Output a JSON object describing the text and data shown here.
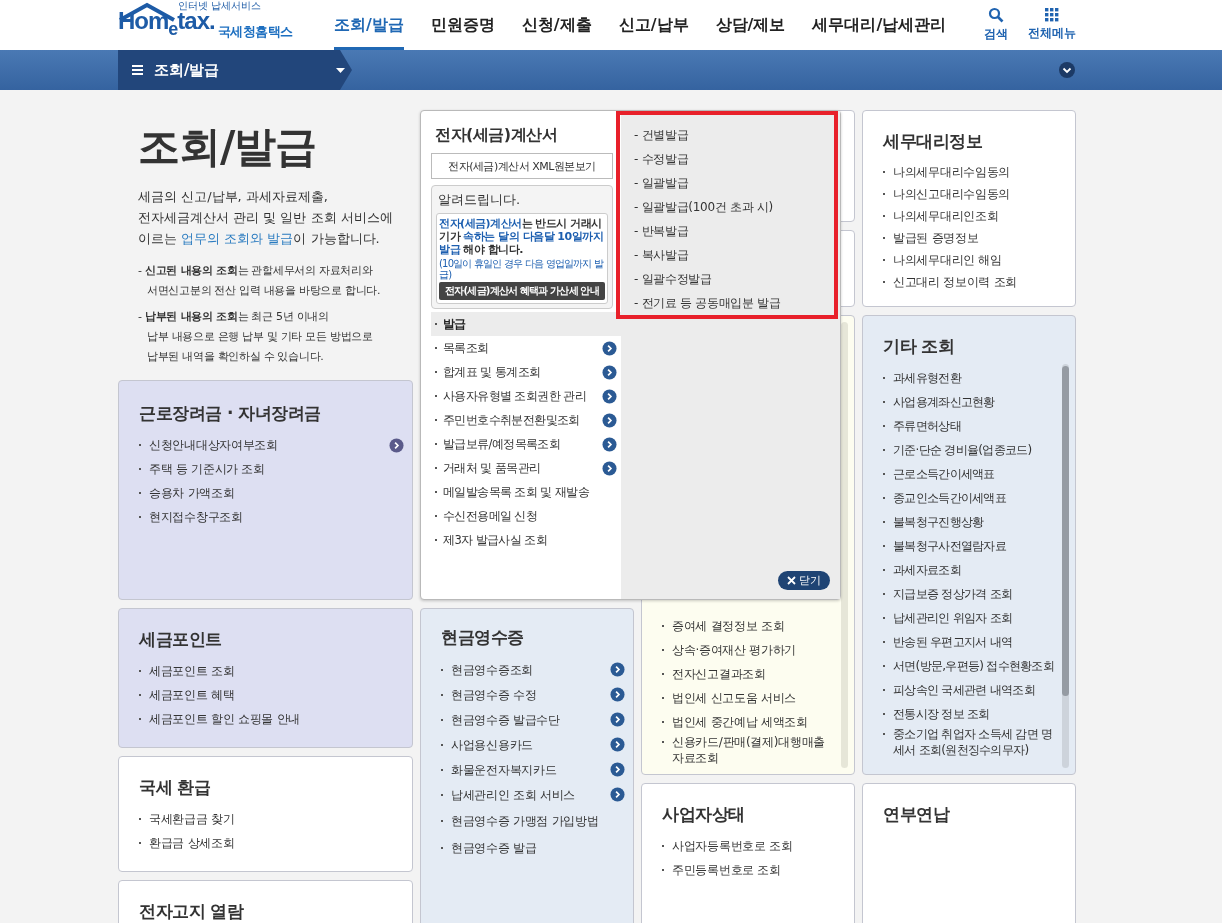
{
  "header": {
    "logo": {
      "tagline": "인터넷 납세서비스",
      "wordmark": "Hom$_{e}$tax.",
      "name": "국세청홈택스"
    },
    "nav": [
      {
        "label": "조회/발급",
        "selected": true
      },
      {
        "label": "민원증명",
        "selected": false
      },
      {
        "label": "신청/제출",
        "selected": false
      },
      {
        "label": "신고/납부",
        "selected": false
      },
      {
        "label": "상담/제보",
        "selected": false
      },
      {
        "label": "세무대리/납세관리",
        "selected": false
      }
    ],
    "tools": [
      {
        "kind": "search",
        "label": "검색"
      },
      {
        "kind": "menu",
        "label": "전체메뉴"
      }
    ]
  },
  "breadcrumb": {
    "label": "조회/발급"
  },
  "intro": {
    "title": "조회/발급",
    "description": "세금의 신고/납부, 과세자료제출,\n전자세금계산서 관리 및 일반 조회 서비스에\n이르는 **업무의 조회와 발급**이 가능합니다.",
    "notes": [
      "- **신고된 내용의 조회**는 관할세무서의 자료처리와\n서면신고분의 전산 입력 내용을 바탕으로 합니다.",
      "- **납부된 내용의 조회**는 최근 5년 이내의\n납부 내용으로 은행 납부 및 기타 모든 방법으로\n납부된 내역을 확인하실 수 있습니다."
    ]
  },
  "columns": [
    {
      "cards": [
        {
          "kind": "list",
          "color": "#dddff2",
          "title": "근로장려금 · 자녀장려금",
          "items": [
            {
              "label": "신청안내대상자여부조회",
              "arrow": true
            },
            {
              "label": "주택 등 기준시가 조회",
              "arrow": false
            },
            {
              "label": "승용차 가액조회",
              "arrow": false
            },
            {
              "label": "현지접수창구조회",
              "arrow": false
            }
          ]
        },
        {
          "kind": "list",
          "color": "#dddff2",
          "title": "세금포인트",
          "items": [
            {
              "label": "세금포인트 조회"
            },
            {
              "label": "세금포인트 혜택"
            },
            {
              "label": "세금포인트 할인 쇼핑몰 안내"
            }
          ]
        },
        {
          "kind": "list",
          "color": "#ffffff",
          "title": "국세 환급",
          "items": [
            {
              "label": "국세환급금 찾기"
            },
            {
              "label": "환급금 상세조회"
            }
          ]
        },
        {
          "kind": "list",
          "color": "#ffffff",
          "title": "전자고지 열람"
        }
      ]
    },
    {
      "cards": [
        {
          "kind": "list",
          "color": "#e4ebf4",
          "title": "현금영수증",
          "items": [
            {
              "label": "현금영수증조회",
              "arrow": true
            },
            {
              "label": "현금영수증 수정",
              "arrow": true
            },
            {
              "label": "현금영수증 발급수단",
              "arrow": true
            },
            {
              "label": "사업용신용카드",
              "arrow": true
            },
            {
              "label": "화물운전자복지카드",
              "arrow": true
            },
            {
              "label": "납세관리인 조회 서비스",
              "arrow": true
            },
            {
              "label": "현금영수증 가맹점 가입방법",
              "arrow": false
            },
            {
              "label": "현금영수증 발급",
              "arrow": false
            }
          ]
        }
      ]
    },
    {
      "cards": [
        {
          "kind": "covered",
          "color": "#ffffff"
        },
        {
          "kind": "covered",
          "color": "#ffffff"
        },
        {
          "kind": "partly_covered",
          "color": "#fdfdf0",
          "scrollable": true,
          "items": [
            {
              "label": "증여세 결정정보 조회"
            },
            {
              "label": "상속·증여재산 평가하기"
            },
            {
              "label": "전자신고결과조회"
            },
            {
              "label": "법인세 신고도움 서비스"
            },
            {
              "label": "법인세 중간예납 세액조회"
            },
            {
              "label": "신용카드/판매(결제)대행매출 자료조회"
            }
          ]
        },
        {
          "kind": "list",
          "color": "#ffffff",
          "title": "사업자상태",
          "items": [
            {
              "label": "사업자등록번호로 조회"
            },
            {
              "label": "주민등록번호로 조회"
            }
          ]
        }
      ]
    },
    {
      "cards": [
        {
          "kind": "list",
          "color": "#ffffff",
          "title": "세무대리정보",
          "items": [
            {
              "label": "나의세무대리수임동의"
            },
            {
              "label": "나의신고대리수임동의"
            },
            {
              "label": "나의세무대리인조회"
            },
            {
              "label": "발급된 증명정보"
            },
            {
              "label": "나의세무대리인 해임"
            },
            {
              "label": "신고대리 정보이력 조회"
            }
          ]
        },
        {
          "kind": "list",
          "color": "#e4ebf4",
          "title": "기타 조회",
          "scrollable": true,
          "items": [
            {
              "label": "과세유형전환"
            },
            {
              "label": "사업용계좌신고현황"
            },
            {
              "label": "주류면허상태"
            },
            {
              "label": "기준·단순 경비율(업종코드)"
            },
            {
              "label": "근로소득간이세액표"
            },
            {
              "label": "종교인소득간이세액표"
            },
            {
              "label": "불복청구진행상황"
            },
            {
              "label": "불복청구사전열람자료"
            },
            {
              "label": "과세자료조회"
            },
            {
              "label": "지급보증 정상가격 조회"
            },
            {
              "label": "납세관리인 위임자 조회"
            },
            {
              "label": "반송된 우편고지서 내역"
            },
            {
              "label": "서면(방문,우편등) 접수현황조회"
            },
            {
              "label": "피상속인 국세관련 내역조회"
            },
            {
              "label": "전통시장 정보 조회"
            },
            {
              "label": "중소기업 취업자 소득세 감면 명세서 조회(원천징수의무자)"
            }
          ]
        },
        {
          "kind": "list",
          "color": "#ffffff",
          "title": "연부연납"
        }
      ]
    }
  ],
  "popup": {
    "title": "전자(세금)계산서",
    "xml_button": "전자(세금)계산서 XML원본보기",
    "notice": {
      "title": "알려드립니다.",
      "message": "**전자(세금)계산서**는 반드시 거래시기가 **속하는 달의 다음달 10일까지 발급** 해야 합니다.",
      "footnote": "(10일이 휴일인 경우 다음 영업일까지 발급)",
      "button": "전자(세금)계산서 혜택과 가산세 안내"
    },
    "menu": [
      {
        "label": "발급",
        "selected": true,
        "arrow": false
      },
      {
        "label": "목록조회",
        "selected": false,
        "arrow": true
      },
      {
        "label": "합계표 및 통계조회",
        "selected": false,
        "arrow": true
      },
      {
        "label": "사용자유형별 조회권한 관리",
        "selected": false,
        "arrow": true
      },
      {
        "label": "주민번호수취분전환및조회",
        "selected": false,
        "arrow": true
      },
      {
        "label": "발급보류/예정목록조회",
        "selected": false,
        "arrow": true
      },
      {
        "label": "거래처 및 품목관리",
        "selected": false,
        "arrow": true
      },
      {
        "label": "메일발송목록 조회 및 재발송",
        "selected": false,
        "arrow": false
      },
      {
        "label": "수신전용메일 신청",
        "selected": false,
        "arrow": false
      },
      {
        "label": "제3자 발급사실 조회",
        "selected": false,
        "arrow": false
      }
    ],
    "submenu": [
      "- 건별발급",
      "- 수정발급",
      "- 일괄발급",
      "- 일괄발급(100건 초과 시)",
      "- 반복발급",
      "- 복사발급",
      "- 일괄수정발급",
      "- 전기료 등 공동매입분 발급"
    ],
    "close": "닫기"
  }
}
